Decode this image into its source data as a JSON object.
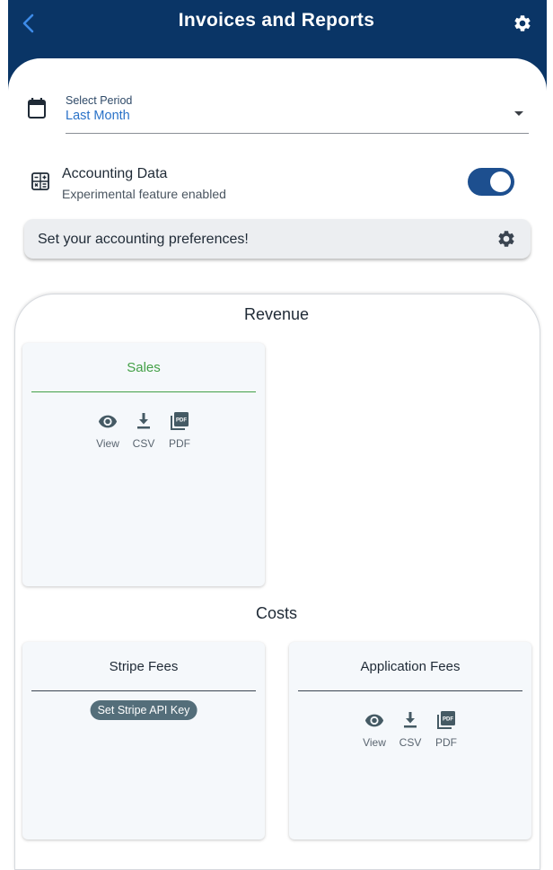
{
  "header": {
    "title": "Invoices and Reports"
  },
  "period": {
    "label": "Select Period",
    "value": "Last Month"
  },
  "accounting": {
    "title": "Accounting Data",
    "subtitle": "Experimental feature enabled",
    "enabled": true
  },
  "preferences": {
    "label": "Set your accounting preferences!"
  },
  "revenue": {
    "title": "Revenue",
    "cards": [
      {
        "title": "Sales",
        "accent": "#43a047",
        "actions": [
          "View",
          "CSV",
          "PDF"
        ]
      }
    ]
  },
  "costs": {
    "title": "Costs",
    "cards": [
      {
        "title": "Stripe Fees",
        "accent": "#3a4450",
        "chip": "Set Stripe API Key"
      },
      {
        "title": "Application Fees",
        "accent": "#3a4450",
        "actions": [
          "View",
          "CSV",
          "PDF"
        ]
      }
    ]
  },
  "icons": [
    "back-icon",
    "gear-icon",
    "calendar-icon",
    "calculator-icon",
    "dropdown-arrow-icon",
    "eye-icon",
    "download-icon",
    "pdf-icon"
  ],
  "colors": {
    "appbar": "#0a3566",
    "toggle_on": "#1d4f8f",
    "link_value": "#2a72c8",
    "sales_accent": "#43a047"
  }
}
